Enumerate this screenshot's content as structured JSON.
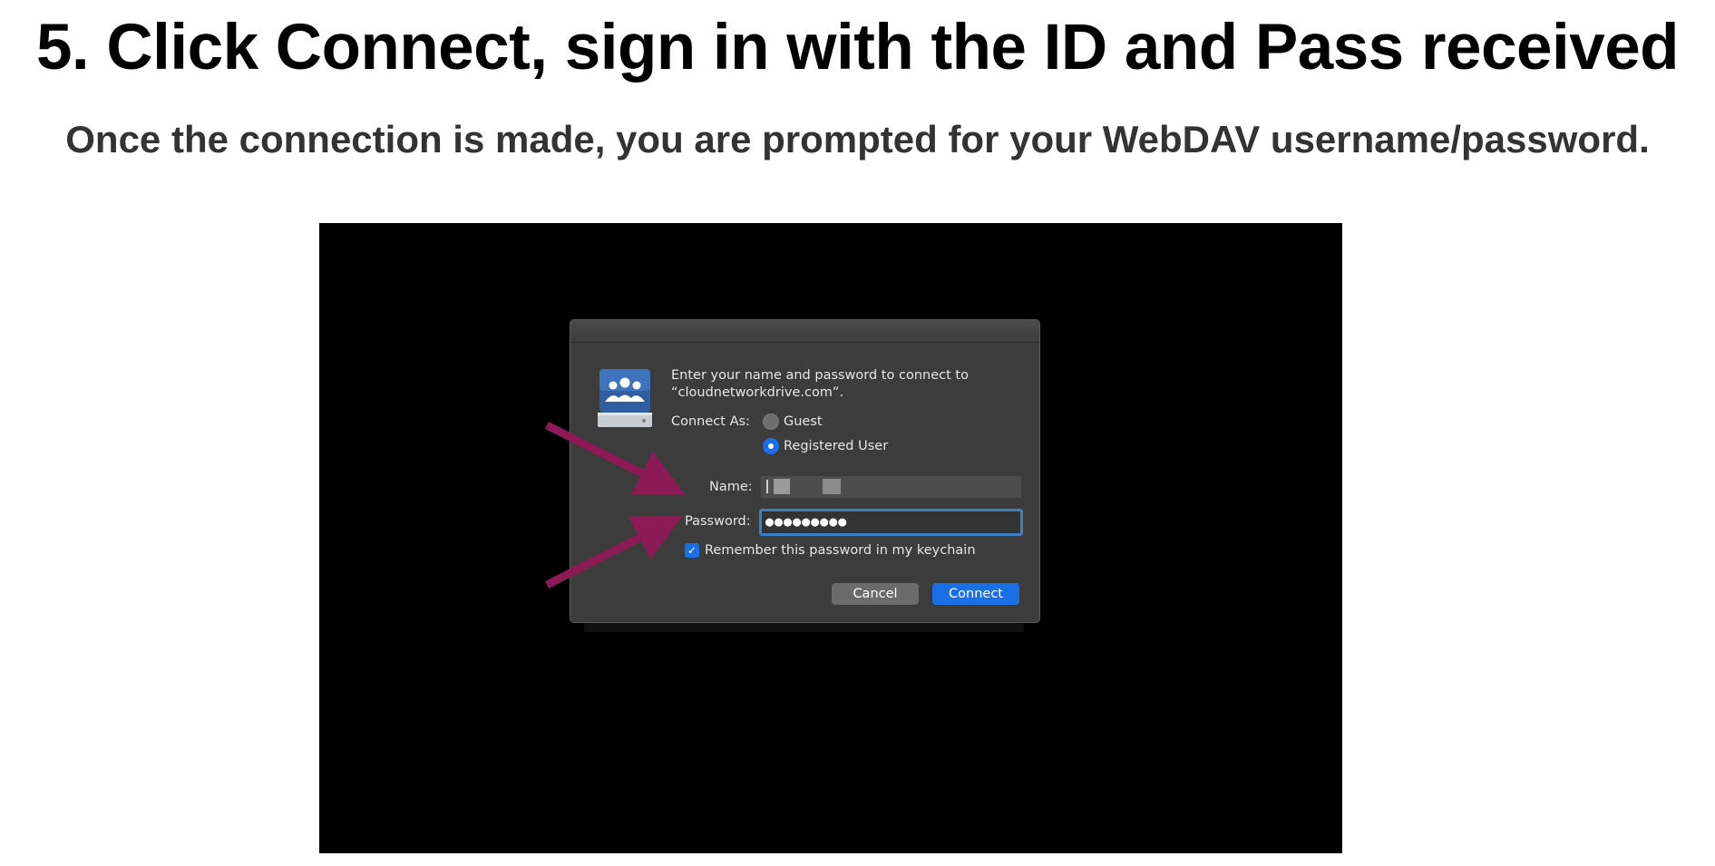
{
  "header": {
    "title": "5. Click Connect, sign in with the ID and Pass received",
    "subtitle": "Once the connection is made, you are prompted for your WebDAV username/password."
  },
  "dialog": {
    "prompt_line1": "Enter your name and password to connect to",
    "prompt_line2": "“cloudnetworkdrive.com”.",
    "connect_as_label": "Connect As:",
    "options": [
      {
        "label": "Guest",
        "selected": false
      },
      {
        "label": "Registered User",
        "selected": true
      }
    ],
    "name_label": "Name:",
    "name_value": "",
    "password_label": "Password:",
    "password_value": "●●●●●●●●●",
    "remember_label": "Remember this password in my keychain",
    "remember_checked": true,
    "cancel_label": "Cancel",
    "connect_label": "Connect",
    "icon": "network-drive-icon"
  },
  "colors": {
    "arrow": "#8b1a55",
    "accent": "#1a6fe6",
    "dialog_bg": "#3c3c3c"
  }
}
